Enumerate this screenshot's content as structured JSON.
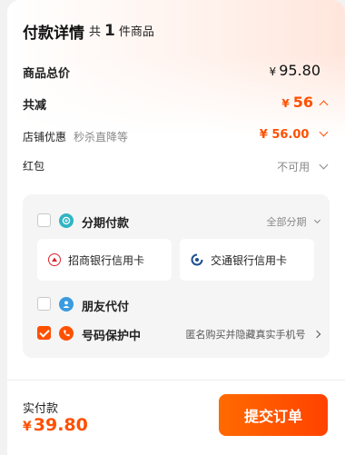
{
  "header": {
    "title": "付款详情",
    "count_prefix": "共",
    "count": "1",
    "count_suffix": "件商品"
  },
  "summary": {
    "total_label": "商品总价",
    "total_currency": "¥",
    "total_value": "95.80",
    "reduce_label": "共减",
    "reduce_currency": "¥",
    "reduce_value": "56",
    "shop_discount_label": "店铺优惠",
    "shop_discount_desc": "秒杀直降等",
    "shop_discount_value": "¥ 56.00",
    "red_packet_label": "红包",
    "red_packet_value": "不可用"
  },
  "payment": {
    "installment_label": "分期付款",
    "installment_action": "全部分期",
    "cards": [
      {
        "label": "招商银行信用卡",
        "icon": "cmb-bank-icon"
      },
      {
        "label": "交通银行信用卡",
        "icon": "bocom-bank-icon"
      }
    ],
    "friend_pay_label": "朋友代付",
    "privacy_label": "号码保护中",
    "privacy_desc": "匿名购买并隐藏真实手机号"
  },
  "footer": {
    "paid_label": "实付款",
    "paid_currency": "¥",
    "paid_value": "39.80",
    "submit_label": "提交订单"
  },
  "colors": {
    "accent": "#ff5000",
    "installment_icon": "#2fb5c4",
    "friend_icon": "#3a9be0",
    "privacy_icon": "#ff5000",
    "cmb_red": "#d7262c",
    "bocom_blue": "#1d4f91"
  }
}
